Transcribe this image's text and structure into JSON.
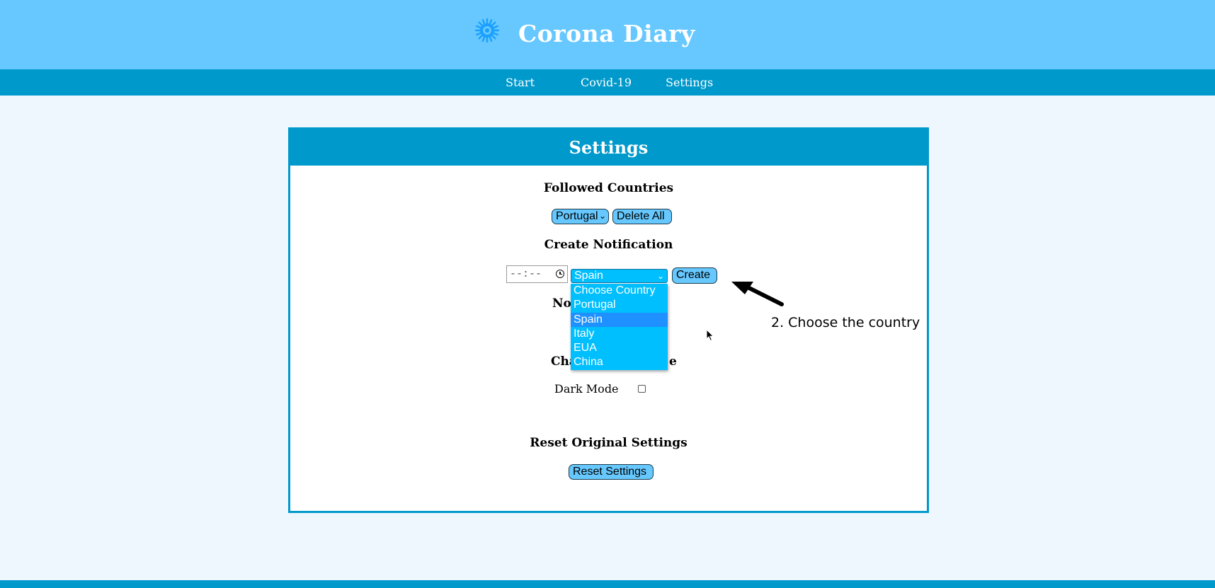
{
  "app": {
    "title": "Corona Diary",
    "logo_icon": "virus-icon",
    "colors": {
      "header_bg": "#66c8ff",
      "nav_bg": "#0099cc",
      "page_bg": "#eef6fe",
      "select_bg": "#00bfff",
      "selected_option": "#1e90ff"
    }
  },
  "nav": {
    "items": [
      "Start",
      "Covid-19",
      "Settings"
    ]
  },
  "settings": {
    "title": "Settings",
    "followed_countries": {
      "heading": "Followed Countries",
      "selected": "Portugal",
      "delete_label": "Delete All"
    },
    "create_notification": {
      "heading": "Create Notification",
      "time_value": "--:--",
      "country_selected": "Spain",
      "create_label": "Create",
      "options": [
        "Choose Country",
        "Portugal",
        "Spain",
        "Italy",
        "EUA",
        "China"
      ],
      "selected_index": 2
    },
    "obscured": {
      "notifications_heading_fragment": "Not",
      "theme_heading_fragment_left": "Cha",
      "theme_heading_fragment_right": "e"
    },
    "theme": {
      "dark_mode_label": "Dark Mode",
      "dark_mode_checked": false
    },
    "reset": {
      "heading": "Reset Original Settings",
      "button_label": "Reset Settings"
    }
  },
  "annotation": {
    "text": "2. Choose the country"
  }
}
